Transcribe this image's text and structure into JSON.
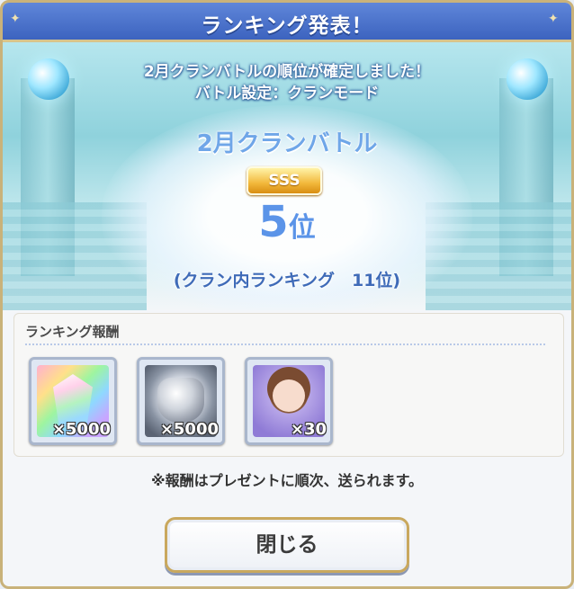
{
  "header": {
    "title": "ランキング発表！"
  },
  "result": {
    "message_line1": "2月クランバトルの順位が確定しました！",
    "message_line2": "バトル設定：クランモード",
    "battle_name": "2月クランバトル",
    "rank_grade": "SSS",
    "place_number": "5",
    "place_unit": "位",
    "clan_inner_ranking": "(クラン内ランキング　11位)"
  },
  "rewards": {
    "label": "ランキング報酬",
    "items": [
      {
        "icon": "rainbow-gem-icon",
        "quantity": "×5000"
      },
      {
        "icon": "silver-medal-icon",
        "quantity": "×5000"
      },
      {
        "icon": "character-portrait-icon",
        "quantity": "×30"
      }
    ]
  },
  "note": "※報酬はプレゼントに順次、送られます。",
  "close_button": {
    "label": "閉じる"
  }
}
